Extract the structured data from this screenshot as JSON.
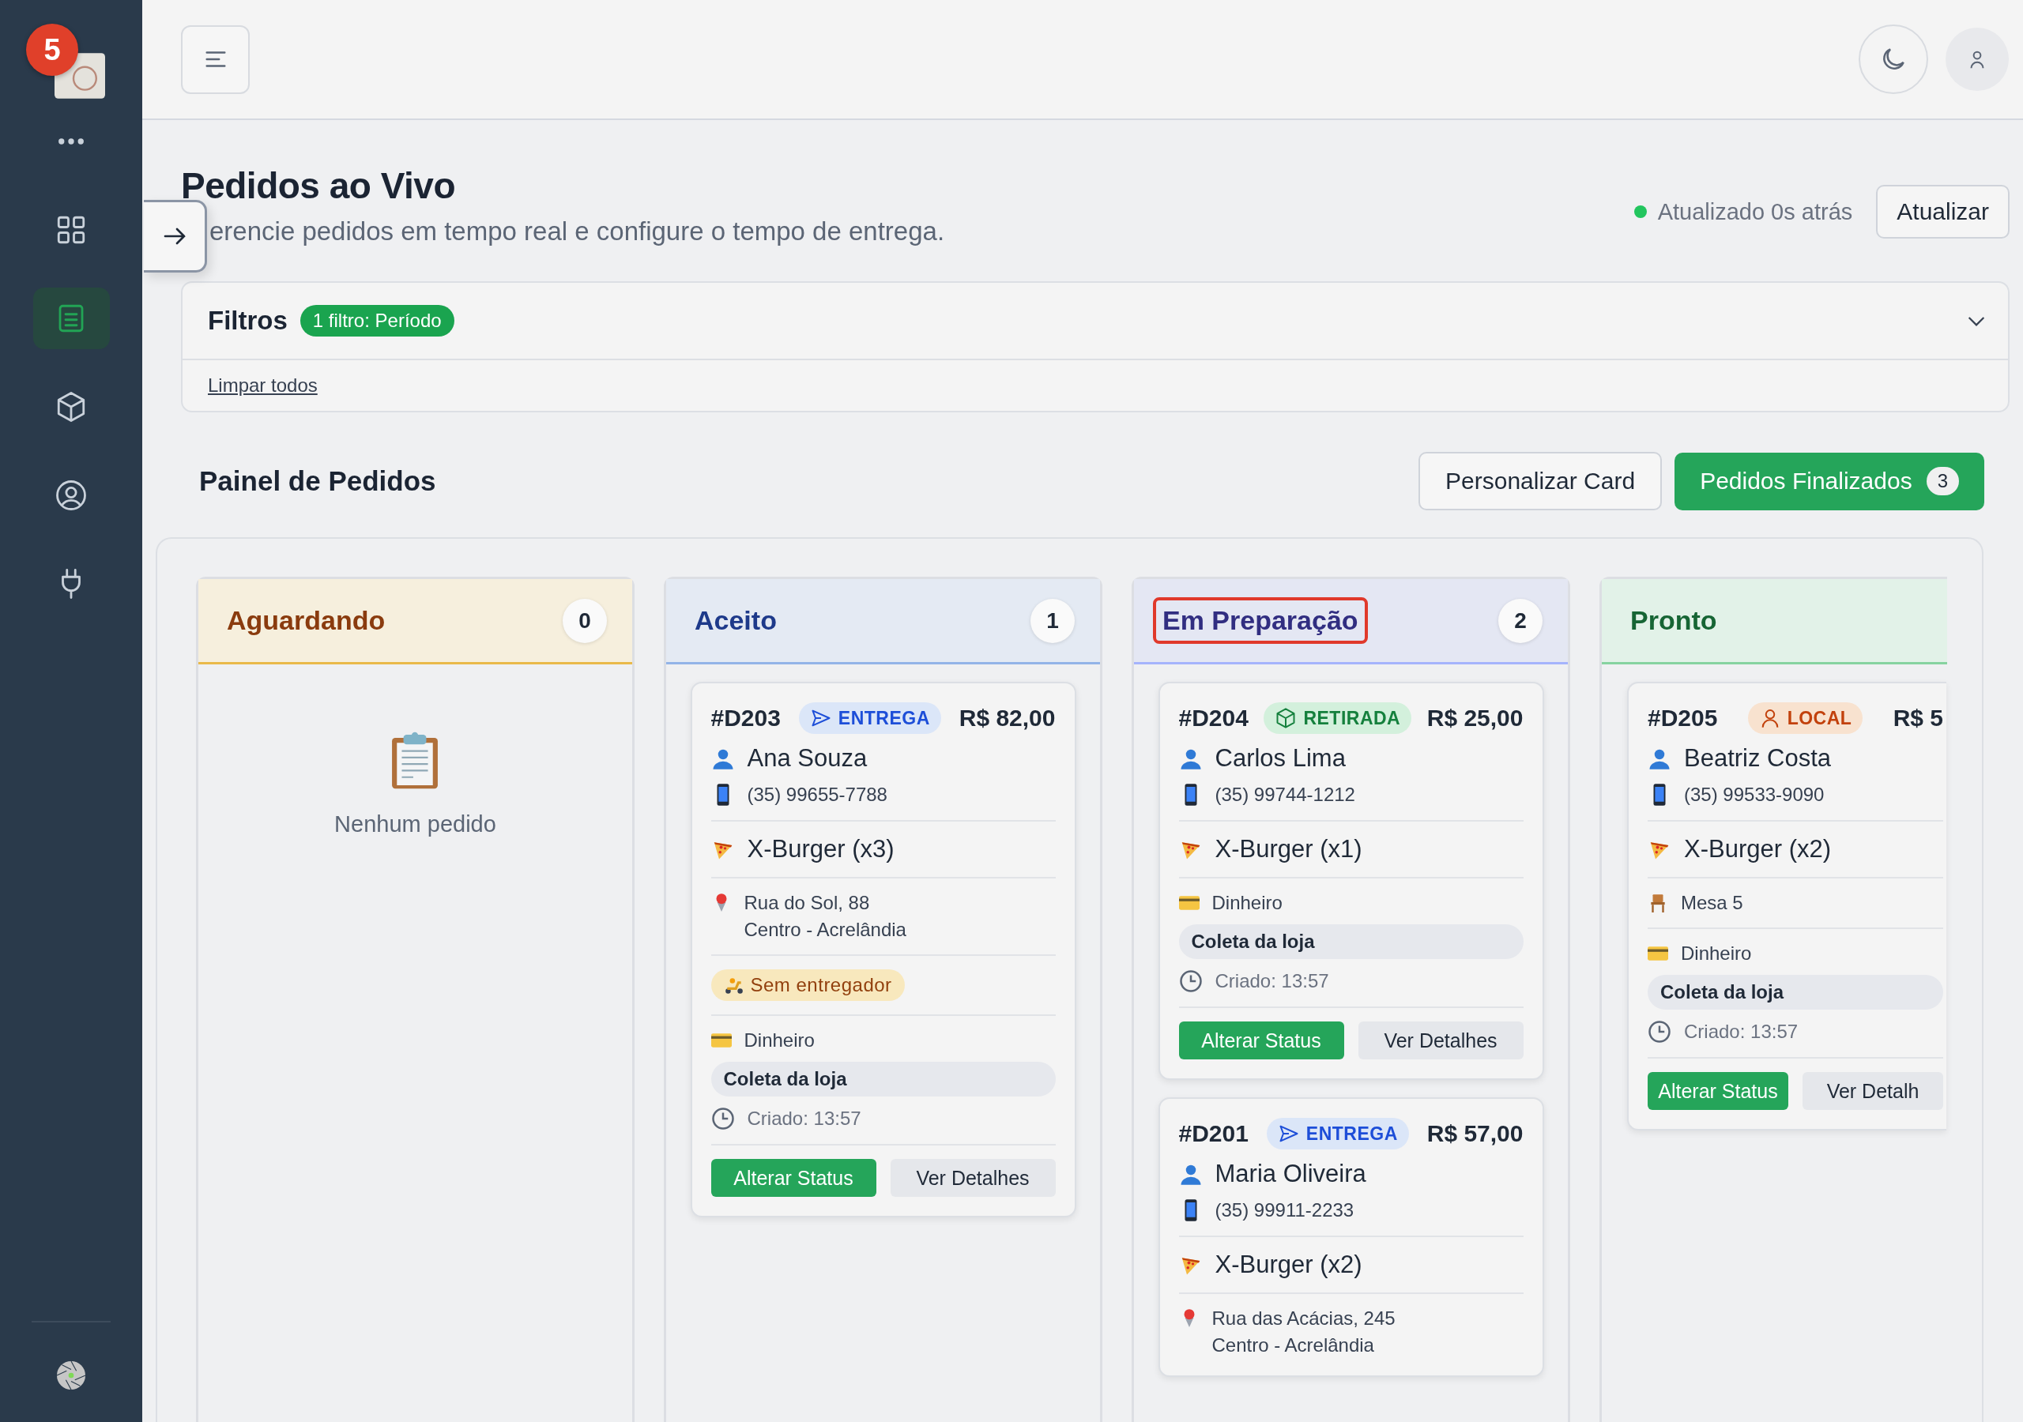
{
  "sidebar": {
    "notification_count": "5",
    "items": [
      {
        "kind": "more",
        "selected": false
      },
      {
        "kind": "grid",
        "selected": false
      },
      {
        "kind": "orders",
        "selected": true
      },
      {
        "kind": "cube",
        "selected": false
      },
      {
        "kind": "account",
        "selected": false
      },
      {
        "kind": "plug",
        "selected": false
      }
    ]
  },
  "page": {
    "title": "Pedidos ao Vivo",
    "subtitle": "erencie pedidos em tempo real e configure o tempo de entrega.",
    "status": "Atualizado 0s atrás",
    "refresh_button": "Atualizar"
  },
  "filters": {
    "title": "Filtros",
    "badge": "1 filtro: Período",
    "clear_link": "Limpar todos"
  },
  "board": {
    "title": "Painel de Pedidos",
    "customize_button": "Personalizar Card",
    "finished_button": {
      "label": "Pedidos Finalizados",
      "count": "3"
    },
    "columns": [
      {
        "kind": "waiting",
        "title": "Aguardando",
        "count": "0",
        "highlighted": false,
        "empty_text": "Nenhum pedido"
      },
      {
        "kind": "accepted",
        "title": "Aceito",
        "count": "1",
        "highlighted": false,
        "cards": [
          {
            "id": "#D203",
            "kind": "delivery",
            "type_label": "ENTREGA",
            "price": "R$ 82,00",
            "customer": "Ana Souza",
            "phone": "(35) 99655-7788",
            "item": "X-Burger (x3)",
            "address": [
              "Rua do Sol, 88",
              "Centro - Acrelândia"
            ],
            "courier": "Sem entregador",
            "payment": "Dinheiro",
            "pickup": "Coleta da loja",
            "created": "Criado: 13:57",
            "actions": [
              "Alterar Status",
              "Ver Detalhes"
            ]
          }
        ]
      },
      {
        "kind": "preparing",
        "title": "Em Preparação",
        "count": "2",
        "highlighted": true,
        "cards": [
          {
            "id": "#D204",
            "kind": "pickup",
            "type_label": "RETIRADA",
            "price": "R$ 25,00",
            "customer": "Carlos Lima",
            "phone": "(35) 99744-1212",
            "item": "X-Burger (x1)",
            "payment": "Dinheiro",
            "pickup": "Coleta da loja",
            "created": "Criado: 13:57",
            "actions": [
              "Alterar Status",
              "Ver Detalhes"
            ]
          },
          {
            "id": "#D201",
            "kind": "delivery",
            "type_label": "ENTREGA",
            "price": "R$ 57,00",
            "customer": "Maria Oliveira",
            "phone": "(35) 99911-2233",
            "item": "X-Burger (x2)",
            "address": [
              "Rua das Acácias, 245",
              "Centro - Acrelândia"
            ]
          }
        ]
      },
      {
        "kind": "ready",
        "title": "Pronto",
        "highlighted": false,
        "cards": [
          {
            "id": "#D205",
            "kind": "local",
            "type_label": "LOCAL",
            "price": "R$ 5",
            "customer": "Beatriz Costa",
            "phone": "(35) 99533-9090",
            "item": "X-Burger (x2)",
            "table": "Mesa 5",
            "payment": "Dinheiro",
            "pickup": "Coleta da loja",
            "created": "Criado: 13:57",
            "actions": [
              "Alterar Status",
              "Ver Detalh"
            ]
          }
        ]
      }
    ]
  }
}
